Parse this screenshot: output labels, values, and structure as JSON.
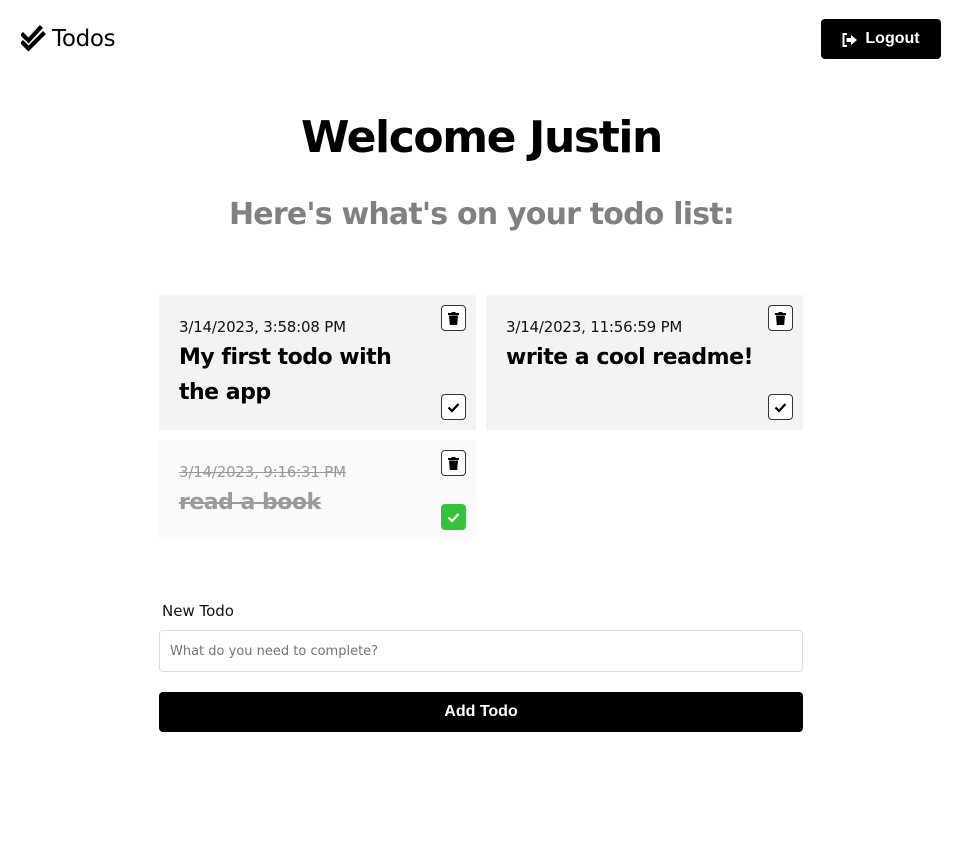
{
  "header": {
    "brand_label": "Todos",
    "brand_icon": "double-check-icon",
    "logout_label": "Logout",
    "logout_icon": "sign-out-icon"
  },
  "main": {
    "welcome": "Welcome Justin",
    "subtitle": "Here's what's on your todo list:"
  },
  "todos": [
    {
      "date": "3/14/2023, 3:58:08 PM",
      "text": "My first todo with the app",
      "completed": false
    },
    {
      "date": "3/14/2023, 11:56:59 PM",
      "text": "write a cool readme!",
      "completed": false
    },
    {
      "date": "3/14/2023, 9:16:31 PM",
      "text": "read a book",
      "completed": true
    }
  ],
  "form": {
    "label": "New Todo",
    "value": "",
    "placeholder": "What do you need to complete?",
    "submit_label": "Add Todo"
  },
  "colors": {
    "accent": "#000000",
    "completed_check": "#34c23a",
    "subtitle": "#808080",
    "card_background": "#f3f3f3"
  }
}
